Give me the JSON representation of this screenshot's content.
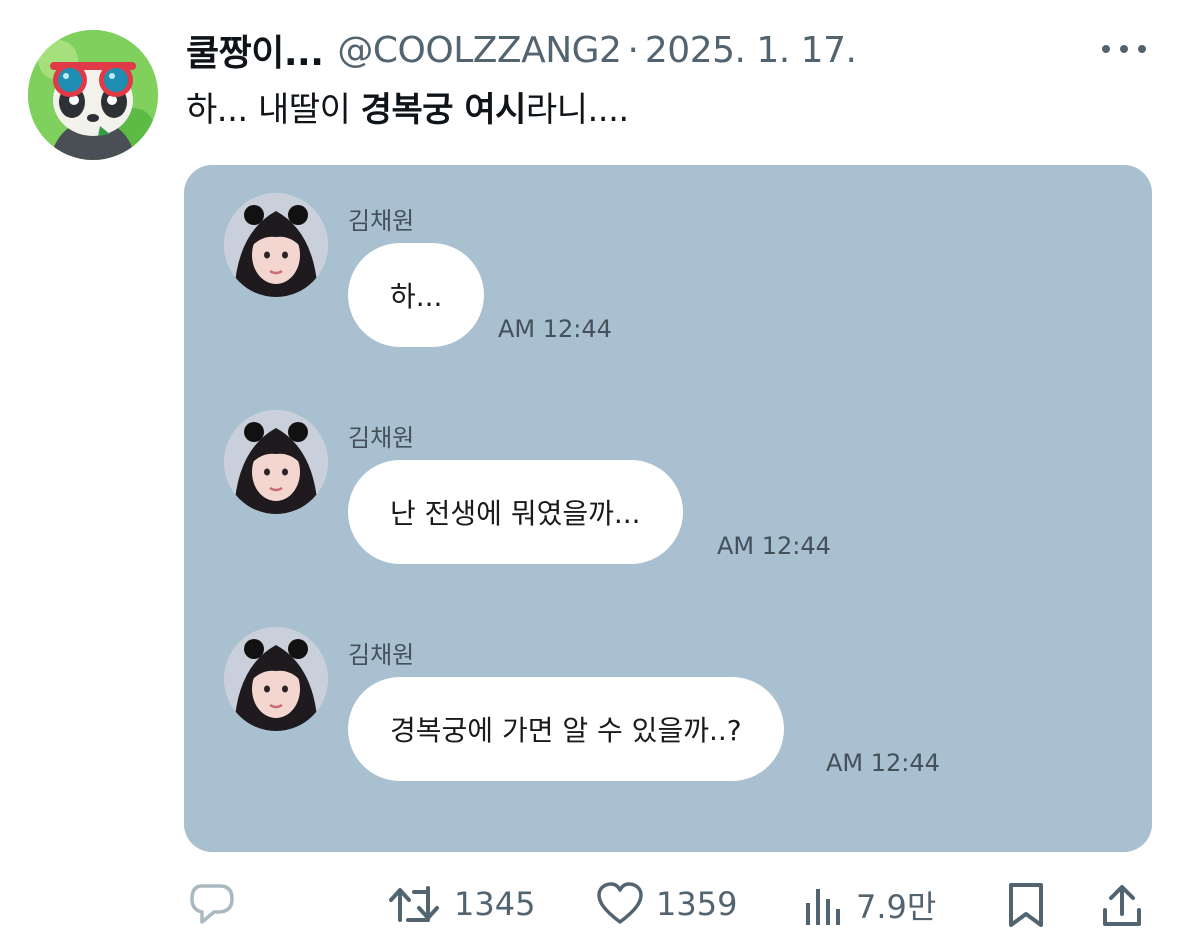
{
  "tweet": {
    "display_name": "쿨짱이...",
    "handle": "@COOLZZANG2",
    "separator": "·",
    "date": "2025. 1. 17.",
    "text_parts": [
      "하... 내딸이 ",
      "경복궁 여시",
      "라니...."
    ]
  },
  "chat": {
    "messages": [
      {
        "sender": "김채원",
        "text": "하...",
        "time": "AM 12:44"
      },
      {
        "sender": "김채원",
        "text": "난 전생에 뭐였을까...",
        "time": "AM 12:44"
      },
      {
        "sender": "김채원",
        "text": "경복궁에 가면 알 수 있을까..?",
        "time": "AM 12:44"
      }
    ]
  },
  "actions": {
    "reply_icon": "reply-icon",
    "retweet_icon": "retweet-icon",
    "retweets": "1345",
    "like_icon": "heart-icon",
    "likes": "1359",
    "views_icon": "views-icon",
    "views": "7.9만",
    "bookmark_icon": "bookmark-icon",
    "share_icon": "share-icon"
  },
  "colors": {
    "chat_background": "#a9c0d1",
    "muted_text": "#536471",
    "bubble": "#ffffff"
  }
}
